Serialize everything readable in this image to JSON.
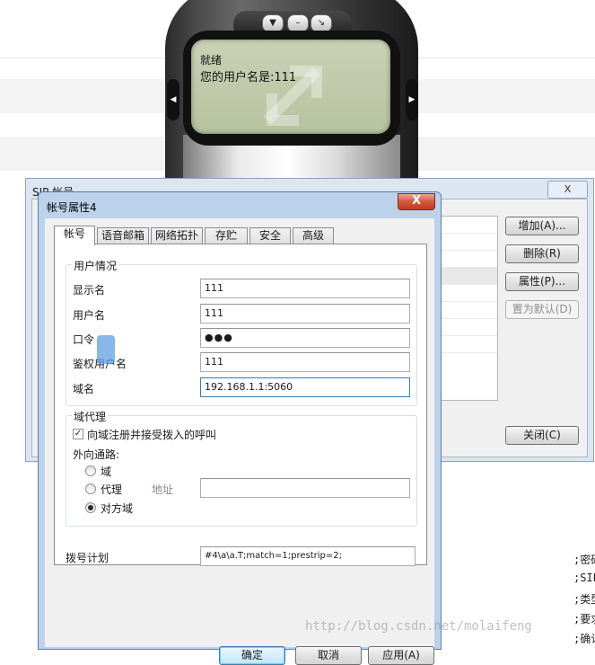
{
  "phone": {
    "lcd_line1": "就绪",
    "lcd_line2": "您的用户名是:111",
    "buttons": {
      "down": "▼",
      "minimize": "–",
      "restore": "↘"
    },
    "side_left": "◀",
    "side_right": "▶"
  },
  "sip_window": {
    "title": "SIP 帐号",
    "close": "X",
    "buttons": {
      "add": "增加(A)...",
      "remove": "删除(R)",
      "properties": "属性(P)...",
      "set_default": "置为默认(D)",
      "close": "关闭(C)"
    }
  },
  "dialog": {
    "title": "帐号属性4",
    "close": "X",
    "tabs": [
      "帐号",
      "语音邮箱",
      "网络拓扑",
      "存贮",
      "安全",
      "高级"
    ],
    "user_group": {
      "legend": "用户情况",
      "display_name_label": "显示名",
      "display_name_value": "111",
      "username_label": "用户名",
      "username_value": "111",
      "password_label": "口令",
      "password_value": "●●●",
      "auth_name_label": "鉴权用户名",
      "auth_name_value": "111",
      "domain_label": "域名",
      "domain_value": "192.168.1.1:5060"
    },
    "proxy_group": {
      "legend": "域代理",
      "register_checkbox_label": "向域注册并接受拨入的呼叫",
      "register_checked": true,
      "outbound_label": "外向通路:",
      "radio_domain": "域",
      "radio_proxy": "代理",
      "address_label": "地址",
      "address_value": "",
      "radio_peer_domain": "对方域",
      "selected": "对方域"
    },
    "dial_plan_label": "拨号计划",
    "dial_plan_value": "#4\\a\\a.T;match=1;prestrip=2;",
    "ok": "确定",
    "cancel": "取消",
    "apply": "应用(A)"
  },
  "side_code": [
    ";密码",
    ";SIP",
    ";类型",
    ";要求",
    ";确认"
  ],
  "watermark_text": "http://blog.csdn.net/molaifeng"
}
